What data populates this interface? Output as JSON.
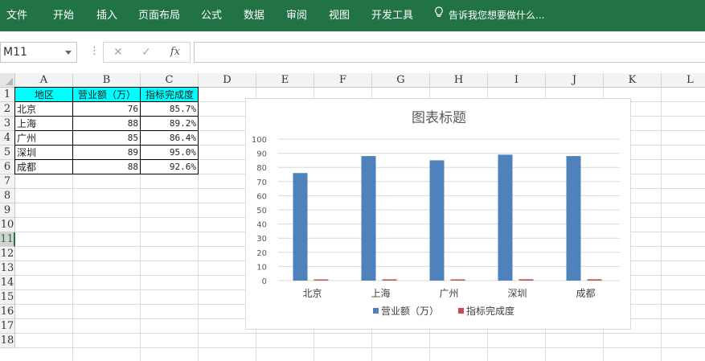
{
  "ribbon": {
    "tabs": [
      "文件",
      "开始",
      "插入",
      "页面布局",
      "公式",
      "数据",
      "审阅",
      "视图",
      "开发工具"
    ],
    "tell_me": "告诉我您想要做什么..."
  },
  "formula_bar": {
    "name_box": "M11",
    "cancel_symbol": "✕",
    "enter_symbol": "✓",
    "fx_symbol": "fx",
    "formula": ""
  },
  "sheet": {
    "columns": [
      "A",
      "B",
      "C",
      "D",
      "E",
      "F",
      "G",
      "H",
      "I",
      "J",
      "K",
      "L"
    ],
    "rows": [
      "1",
      "2",
      "3",
      "4",
      "5",
      "6",
      "7",
      "8",
      "9",
      "10",
      "11",
      "12",
      "13",
      "14",
      "15",
      "16",
      "17",
      "18"
    ],
    "selected_row": "11",
    "table": {
      "headers": [
        "地区",
        "营业额（万）",
        "指标完成度"
      ],
      "rows": [
        [
          "北京",
          "76",
          "85.7%"
        ],
        [
          "上海",
          "88",
          "89.2%"
        ],
        [
          "广州",
          "85",
          "86.4%"
        ],
        [
          "深圳",
          "89",
          "95.0%"
        ],
        [
          "成都",
          "88",
          "92.6%"
        ]
      ]
    }
  },
  "chart_data": {
    "type": "bar",
    "title": "图表标题",
    "categories": [
      "北京",
      "上海",
      "广州",
      "深圳",
      "成都"
    ],
    "series": [
      {
        "name": "营业额（万）",
        "values": [
          76,
          88,
          85,
          89,
          88
        ],
        "color": "#4f81bd"
      },
      {
        "name": "指标完成度",
        "values": [
          0.857,
          0.892,
          0.864,
          0.95,
          0.926
        ],
        "color": "#c0504d"
      }
    ],
    "ylim": [
      0,
      100
    ],
    "yticks": [
      0,
      10,
      20,
      30,
      40,
      50,
      60,
      70,
      80,
      90,
      100
    ],
    "grid": true,
    "legend": "bottom"
  },
  "colors": {
    "ribbon": "#217346",
    "header_fill": "#00ffff"
  }
}
